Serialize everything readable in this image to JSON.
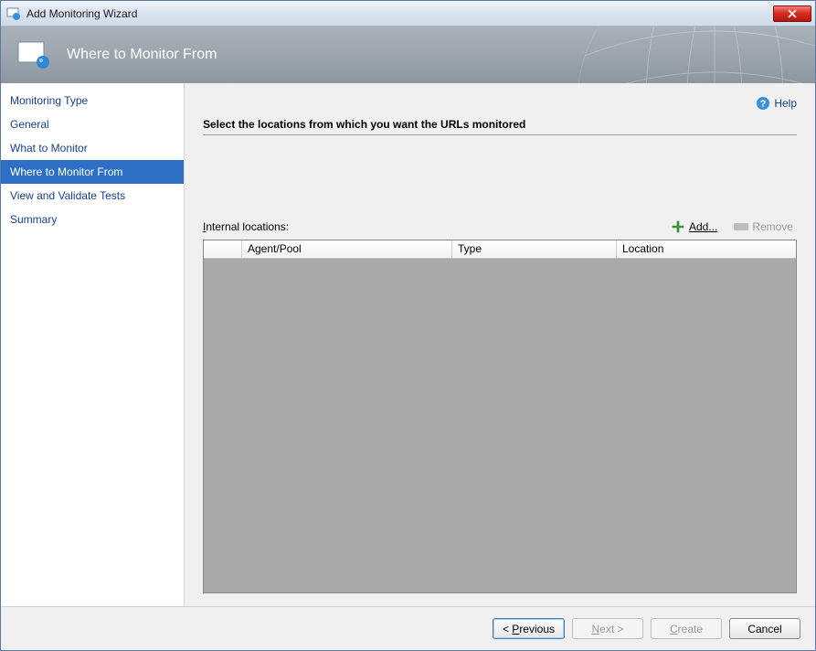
{
  "window": {
    "title": "Add Monitoring Wizard"
  },
  "banner": {
    "title": "Where to Monitor From"
  },
  "sidebar": {
    "items": [
      {
        "label": "Monitoring Type",
        "selected": false
      },
      {
        "label": "General",
        "selected": false
      },
      {
        "label": "What to Monitor",
        "selected": false
      },
      {
        "label": "Where to Monitor From",
        "selected": true
      },
      {
        "label": "View and Validate Tests",
        "selected": false
      },
      {
        "label": "Summary",
        "selected": false
      }
    ]
  },
  "content": {
    "help_label": "Help",
    "instruction": "Select the locations from which you want the URLs monitored",
    "table_label": "Internal locations:",
    "add_label": "Add...",
    "remove_label": "Remove",
    "columns": {
      "col0": "",
      "col1": "Agent/Pool",
      "col2": "Type",
      "col3": "Location"
    }
  },
  "footer": {
    "previous_prefix": "< ",
    "previous_u": "P",
    "previous_rest": "revious",
    "next_u": "N",
    "next_rest": "ext >",
    "create_u": "C",
    "create_rest": "reate",
    "cancel": "Cancel"
  }
}
